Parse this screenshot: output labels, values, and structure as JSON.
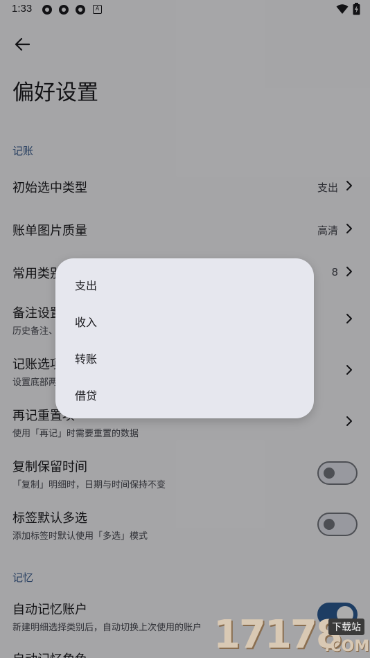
{
  "status_bar": {
    "time": "1:33",
    "notif_badge": "A"
  },
  "page": {
    "title": "偏好设置",
    "back_label": "back"
  },
  "sections": {
    "accounting": {
      "header": "记账"
    },
    "memory": {
      "header": "记忆"
    }
  },
  "rows": {
    "initial_type": {
      "title": "初始选中类型",
      "value": "支出"
    },
    "image_quality": {
      "title": "账单图片质量",
      "value": "高清"
    },
    "common_category": {
      "title": "常用类别",
      "value": "8"
    },
    "note_settings": {
      "title": "备注设置",
      "subtitle": "历史备注、"
    },
    "accounting_options": {
      "title": "记账选项",
      "subtitle": "设置底部两"
    },
    "reset_on_again": {
      "title": "再记重置项",
      "subtitle": "使用「再记」时需要重置的数据"
    },
    "copy_keep_time": {
      "title": "复制保留时间",
      "subtitle": "「复制」明细时，日期与时间保持不变",
      "enabled": false
    },
    "tag_multi_select": {
      "title": "标签默认多选",
      "subtitle": "添加标签时默认使用「多选」模式",
      "enabled": false
    },
    "auto_remember_account": {
      "title": "自动记忆账户",
      "subtitle": "新建明细选择类别后，自动切换上次使用的账户",
      "enabled": true
    },
    "auto_remember_role": {
      "title": "自动记忆角色"
    }
  },
  "menu": {
    "items": [
      "支出",
      "收入",
      "转账",
      "借贷"
    ]
  },
  "watermark": {
    "text": "17178",
    "tag": "下载站",
    "suffix": ".COM"
  },
  "colors": {
    "accent": "#2c5a93",
    "section_header": "#3b5d8f",
    "background": "#f4f4f7",
    "menu_bg": "#e6e7ee"
  }
}
